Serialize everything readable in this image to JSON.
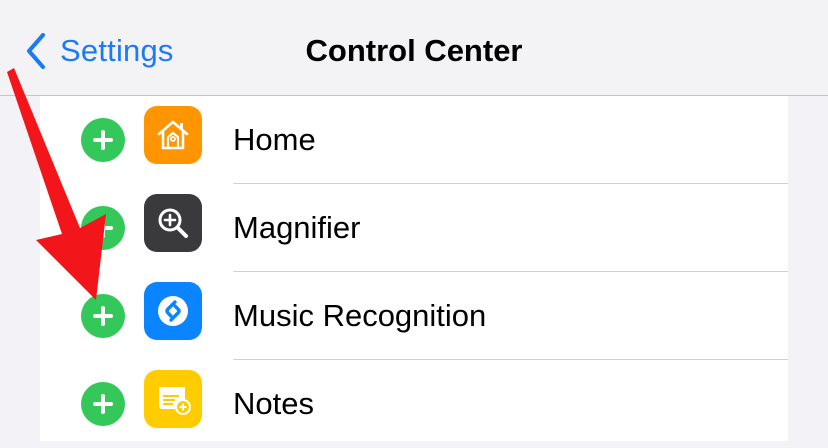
{
  "nav": {
    "back_label": "Settings",
    "title": "Control Center"
  },
  "colors": {
    "accent": "#1a7cf5",
    "add_button": "#34c759",
    "annotation_arrow": "#f2161b"
  },
  "controls": [
    {
      "label": "Home",
      "icon": "home-icon",
      "icon_bg": "#ff9500"
    },
    {
      "label": "Magnifier",
      "icon": "magnifier-icon",
      "icon_bg": "#3a3a3c"
    },
    {
      "label": "Music Recognition",
      "icon": "shazam-icon",
      "icon_bg": "#0a84ff"
    },
    {
      "label": "Notes",
      "icon": "notes-icon",
      "icon_bg": "#ffcc00"
    }
  ]
}
